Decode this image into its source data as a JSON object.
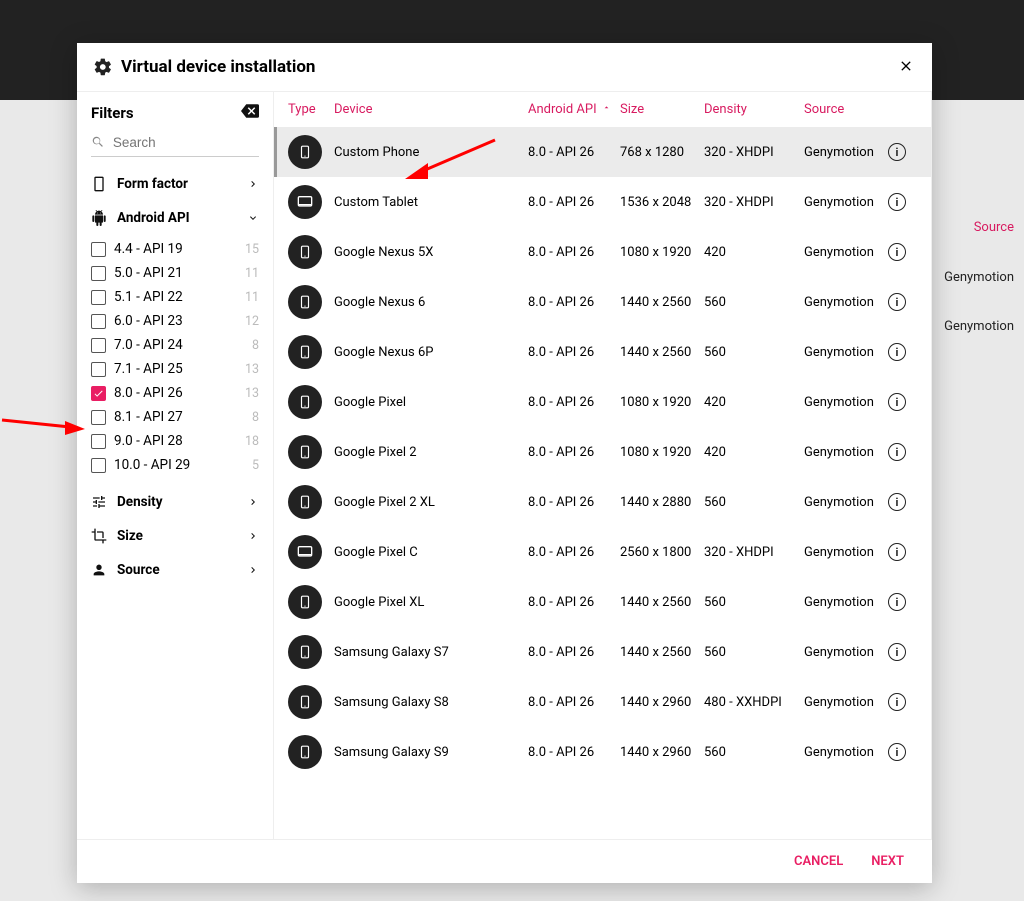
{
  "modal": {
    "title": "Virtual device installation",
    "filters_label": "Filters",
    "search_placeholder": "Search",
    "categories": {
      "form_factor": "Form factor",
      "android_api": "Android API",
      "density": "Density",
      "size": "Size",
      "source": "Source"
    },
    "api_filters": [
      {
        "label": "4.4 - API 19",
        "count": "15",
        "checked": false
      },
      {
        "label": "5.0 - API 21",
        "count": "11",
        "checked": false
      },
      {
        "label": "5.1 - API 22",
        "count": "11",
        "checked": false
      },
      {
        "label": "6.0 - API 23",
        "count": "12",
        "checked": false
      },
      {
        "label": "7.0 - API 24",
        "count": "8",
        "checked": false
      },
      {
        "label": "7.1 - API 25",
        "count": "13",
        "checked": false
      },
      {
        "label": "8.0 - API 26",
        "count": "13",
        "checked": true
      },
      {
        "label": "8.1 - API 27",
        "count": "8",
        "checked": false
      },
      {
        "label": "9.0 - API 28",
        "count": "18",
        "checked": false
      },
      {
        "label": "10.0 - API 29",
        "count": "5",
        "checked": false
      }
    ],
    "table_headers": {
      "type": "Type",
      "device": "Device",
      "api": "Android API",
      "size": "Size",
      "density": "Density",
      "source": "Source"
    },
    "devices": [
      {
        "type": "phone",
        "name": "Custom Phone",
        "api": "8.0 - API 26",
        "size": "768 x 1280",
        "density": "320 - XHDPI",
        "source": "Genymotion",
        "selected": true
      },
      {
        "type": "tablet",
        "name": "Custom Tablet",
        "api": "8.0 - API 26",
        "size": "1536 x 2048",
        "density": "320 - XHDPI",
        "source": "Genymotion"
      },
      {
        "type": "phone",
        "name": "Google Nexus 5X",
        "api": "8.0 - API 26",
        "size": "1080 x 1920",
        "density": "420",
        "source": "Genymotion"
      },
      {
        "type": "phone",
        "name": "Google Nexus 6",
        "api": "8.0 - API 26",
        "size": "1440 x 2560",
        "density": "560",
        "source": "Genymotion"
      },
      {
        "type": "phone",
        "name": "Google Nexus 6P",
        "api": "8.0 - API 26",
        "size": "1440 x 2560",
        "density": "560",
        "source": "Genymotion"
      },
      {
        "type": "phone",
        "name": "Google Pixel",
        "api": "8.0 - API 26",
        "size": "1080 x 1920",
        "density": "420",
        "source": "Genymotion"
      },
      {
        "type": "phone",
        "name": "Google Pixel 2",
        "api": "8.0 - API 26",
        "size": "1080 x 1920",
        "density": "420",
        "source": "Genymotion"
      },
      {
        "type": "phone",
        "name": "Google Pixel 2 XL",
        "api": "8.0 - API 26",
        "size": "1440 x 2880",
        "density": "560",
        "source": "Genymotion"
      },
      {
        "type": "tablet",
        "name": "Google Pixel C",
        "api": "8.0 - API 26",
        "size": "2560 x 1800",
        "density": "320 - XHDPI",
        "source": "Genymotion"
      },
      {
        "type": "phone",
        "name": "Google Pixel XL",
        "api": "8.0 - API 26",
        "size": "1440 x 2560",
        "density": "560",
        "source": "Genymotion"
      },
      {
        "type": "phone",
        "name": "Samsung Galaxy S7",
        "api": "8.0 - API 26",
        "size": "1440 x 2560",
        "density": "560",
        "source": "Genymotion"
      },
      {
        "type": "phone",
        "name": "Samsung Galaxy S8",
        "api": "8.0 - API 26",
        "size": "1440 x 2960",
        "density": "480 - XXHDPI",
        "source": "Genymotion"
      },
      {
        "type": "phone",
        "name": "Samsung Galaxy S9",
        "api": "8.0 - API 26",
        "size": "1440 x 2960",
        "density": "560",
        "source": "Genymotion"
      }
    ],
    "footer": {
      "cancel": "CANCEL",
      "next": "NEXT"
    }
  },
  "background": {
    "source_header": "Source",
    "rows": [
      "Genymotion",
      "Genymotion"
    ]
  }
}
